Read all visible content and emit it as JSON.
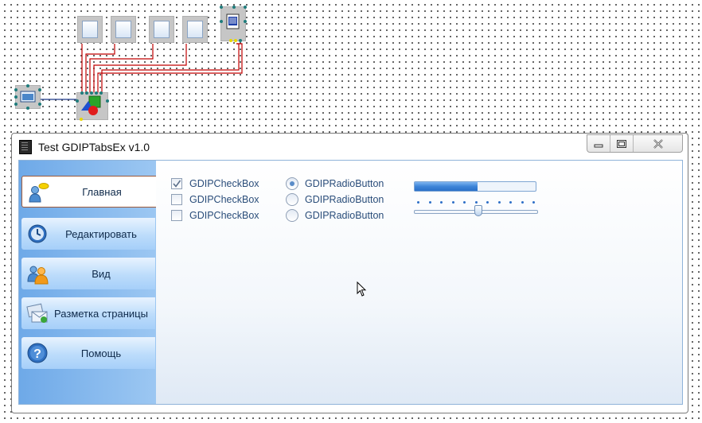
{
  "window": {
    "title": "Test GDIPTabsEx v1.0",
    "caption_buttons": [
      "minimize",
      "maximize",
      "close"
    ]
  },
  "sidebar": {
    "tabs": [
      {
        "label": "Главная",
        "icon": "user-chat-icon",
        "active": true
      },
      {
        "label": "Редактировать",
        "icon": "clock-icon",
        "active": false
      },
      {
        "label": "Вид",
        "icon": "users-icon",
        "active": false
      },
      {
        "label": "Разметка страницы",
        "icon": "mail-icon",
        "active": false
      },
      {
        "label": "Помощь",
        "icon": "help-icon",
        "active": false
      }
    ]
  },
  "content": {
    "checkboxes": [
      {
        "label": "GDIPCheckBox",
        "checked": true
      },
      {
        "label": "GDIPCheckBox",
        "checked": false
      },
      {
        "label": "GDIPCheckBox",
        "checked": false
      }
    ],
    "radios": [
      {
        "label": "GDIPRadioButton",
        "selected": true
      },
      {
        "label": "GDIPRadioButton",
        "selected": false
      },
      {
        "label": "GDIPRadioButton",
        "selected": false
      }
    ],
    "progress": 0.52,
    "slider": 0.52
  },
  "colors": {
    "sidebar": "#7fb4ec",
    "progress_fill": "#3d84d8",
    "wire": "#c00000",
    "link_wire": "#1e3a8a",
    "active_tab_border": "#9c5a3c"
  }
}
